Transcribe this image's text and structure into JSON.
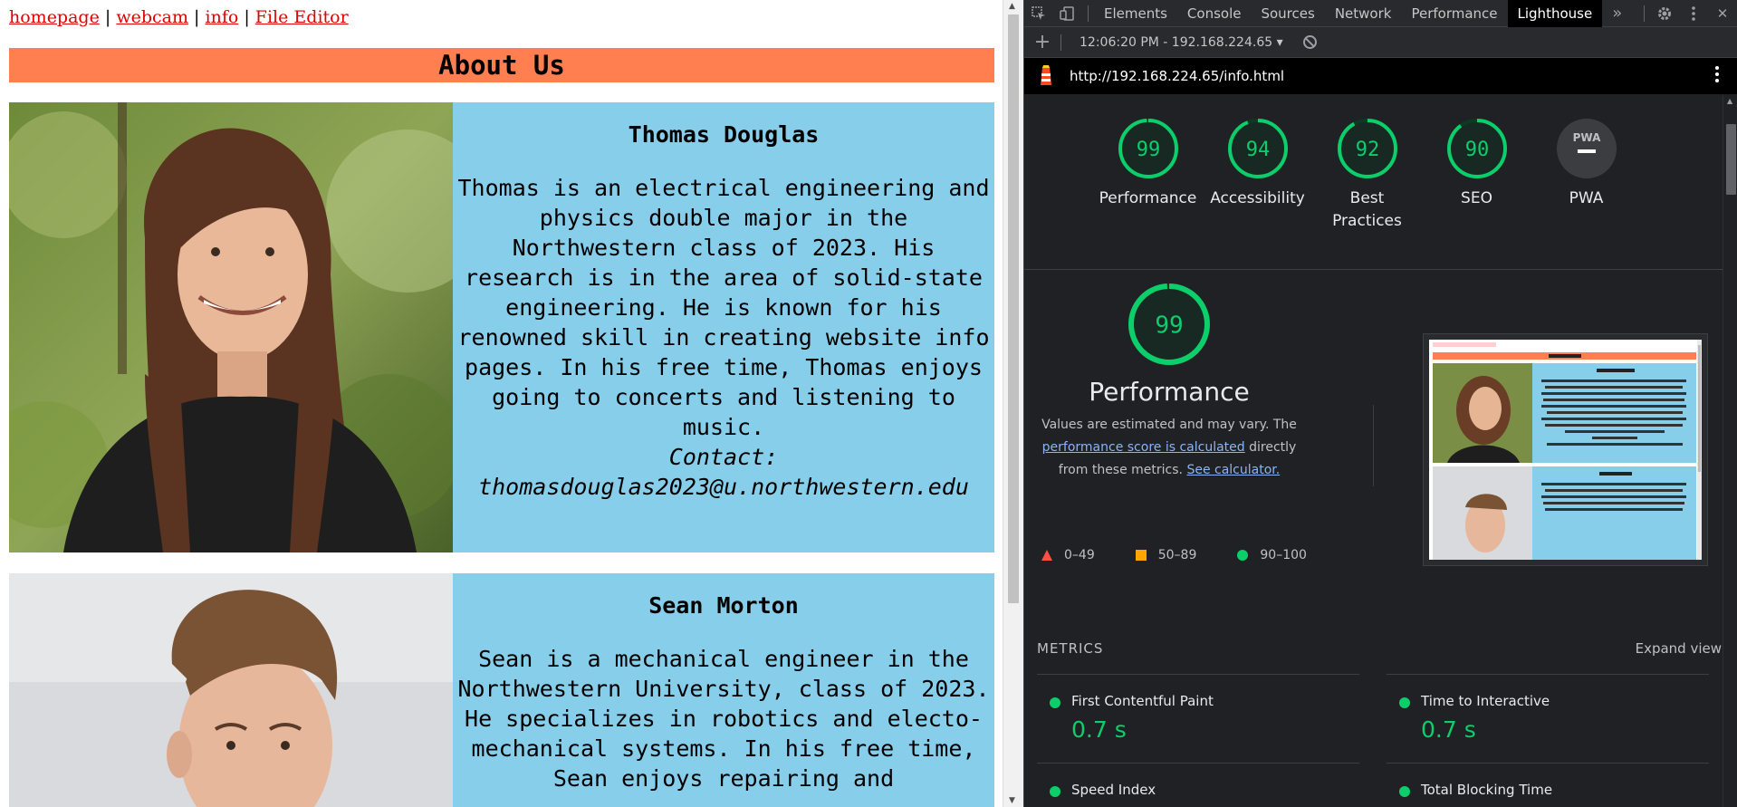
{
  "page": {
    "nav": {
      "links": [
        "homepage",
        "webcam",
        "info",
        "File Editor"
      ],
      "separator": "|"
    },
    "heading": "About Us",
    "people": [
      {
        "name": "Thomas Douglas",
        "bio": "Thomas is an electrical engineering and physics double major in the Northwestern class of 2023. His research is in the area of solid-state engineering. He is known for his renowned skill in creating website info pages. In his free time, Thomas enjoys going to concerts and listening to music.",
        "contact": "Contact: thomasdouglas2023@u.northwestern.edu"
      },
      {
        "name": "Sean Morton",
        "bio": "Sean is a mechanical engineer in the Northwestern University, class of 2023. He specializes in robotics and electo-mechanical systems. In his free time, Sean enjoys repairing and"
      }
    ]
  },
  "devtools": {
    "tabs": [
      "Elements",
      "Console",
      "Sources",
      "Network",
      "Performance",
      "Lighthouse"
    ],
    "active_tab": "Lighthouse",
    "more_tabs_icon": "»",
    "toolbar": {
      "report_select": "12:06:20 PM - 192.168.224.65",
      "caret": "▾"
    },
    "url": "http://192.168.224.65/info.html",
    "gauges": [
      {
        "score": 99,
        "label": "Performance"
      },
      {
        "score": 94,
        "label": "Accessibility"
      },
      {
        "score": 92,
        "label": "Best Practices"
      },
      {
        "score": 90,
        "label": "SEO"
      },
      {
        "score": null,
        "label": "PWA",
        "badge": "PWA"
      }
    ],
    "performance": {
      "score": 99,
      "title": "Performance",
      "desc_1": "Values are estimated and may vary. The",
      "desc_link": "performance score is calculated",
      "desc_2": "directly from these metrics.",
      "calc_link": "See calculator."
    },
    "legend": [
      {
        "range": "0–49",
        "color": "#ff4e42",
        "shape": "triangle"
      },
      {
        "range": "50–89",
        "color": "#ffa400",
        "shape": "square"
      },
      {
        "range": "90–100",
        "color": "#0cce6b",
        "shape": "circle"
      }
    ],
    "metrics": {
      "heading": "METRICS",
      "expand": "Expand view",
      "items": [
        {
          "name": "First Contentful Paint",
          "value": "0.7 s"
        },
        {
          "name": "Time to Interactive",
          "value": "0.7 s"
        },
        {
          "name": "Speed Index",
          "value": ""
        },
        {
          "name": "Total Blocking Time",
          "value": ""
        }
      ]
    },
    "colors": {
      "pass": "#0cce6b",
      "gauge_track": "#0c3a22",
      "about_bar": "#ff7f50",
      "bio_box": "#87ceeb",
      "nav_link": "#e00000"
    }
  }
}
